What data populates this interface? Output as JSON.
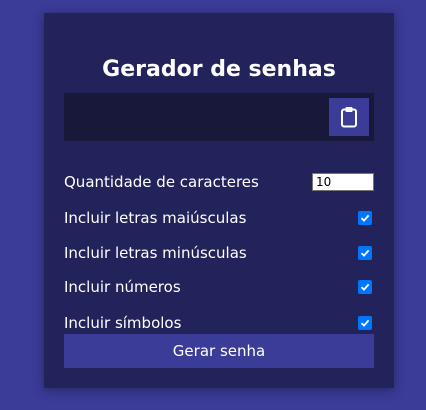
{
  "app": {
    "title": "Gerador de senhas"
  },
  "result": {
    "value": "",
    "copy_icon": "clipboard-icon"
  },
  "options": {
    "length_label": "Quantidade de caracteres",
    "length_value": "10",
    "uppercase_label": "Incluir letras maiúsculas",
    "uppercase_checked": true,
    "lowercase_label": "Incluir letras minúsculas",
    "lowercase_checked": true,
    "numbers_label": "Incluir números",
    "numbers_checked": true,
    "symbols_label": "Incluir símbolos",
    "symbols_checked": true
  },
  "actions": {
    "generate_label": "Gerar senha"
  },
  "colors": {
    "background": "#3b3b98",
    "card": "#23235b",
    "result_box": "#18183b",
    "accent": "#3b3b98",
    "checkbox": "#0075ff"
  }
}
